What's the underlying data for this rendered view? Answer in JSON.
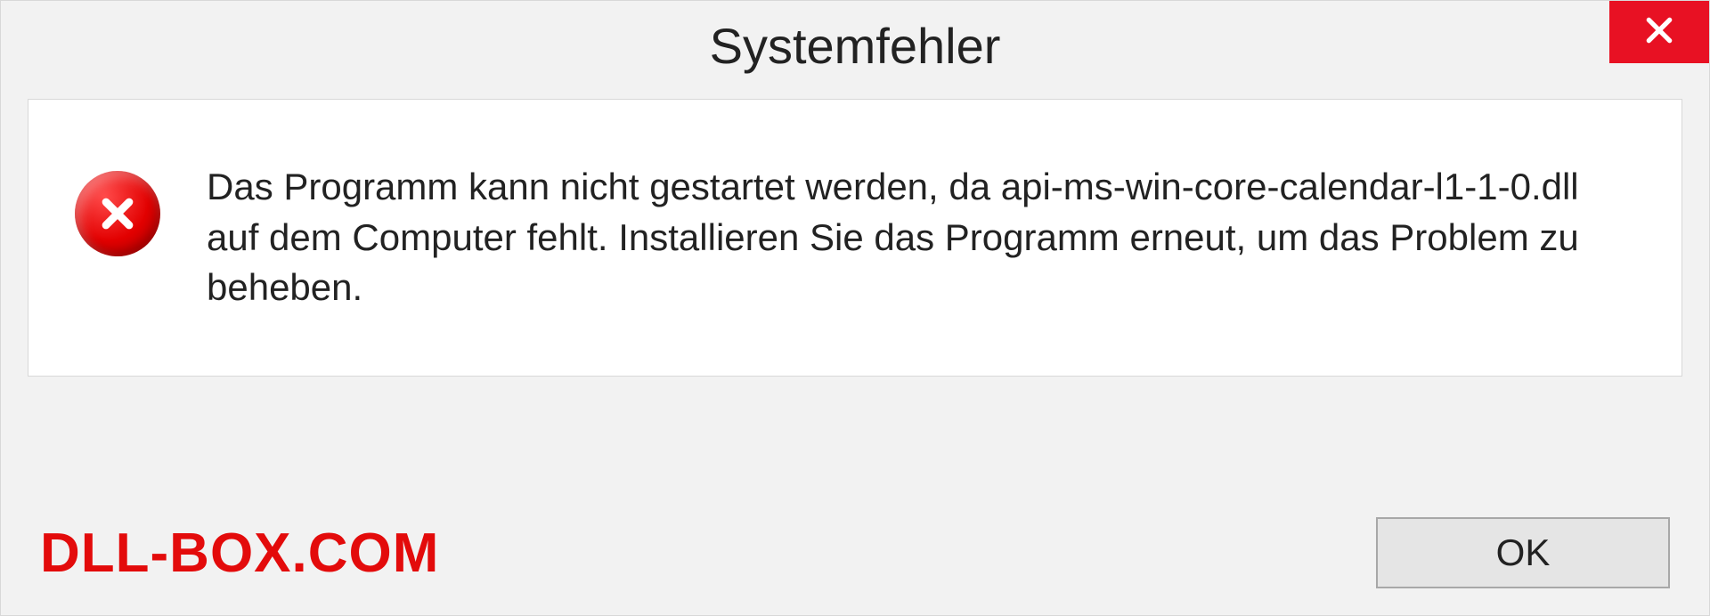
{
  "titlebar": {
    "title": "Systemfehler"
  },
  "message": {
    "text": "Das Programm kann nicht gestartet werden, da api-ms-win-core-calendar-l1-1-0.dll auf dem Computer fehlt. Installieren Sie das Programm erneut, um das Problem zu beheben."
  },
  "footer": {
    "watermark": "DLL-BOX.COM",
    "ok_label": "OK"
  },
  "icons": {
    "close": "close-icon",
    "error": "error-icon"
  },
  "colors": {
    "close_bg": "#e81123",
    "error_red": "#e20000",
    "watermark_red": "#e30b0b",
    "panel_bg": "#ffffff",
    "dialog_bg": "#f2f2f2"
  }
}
